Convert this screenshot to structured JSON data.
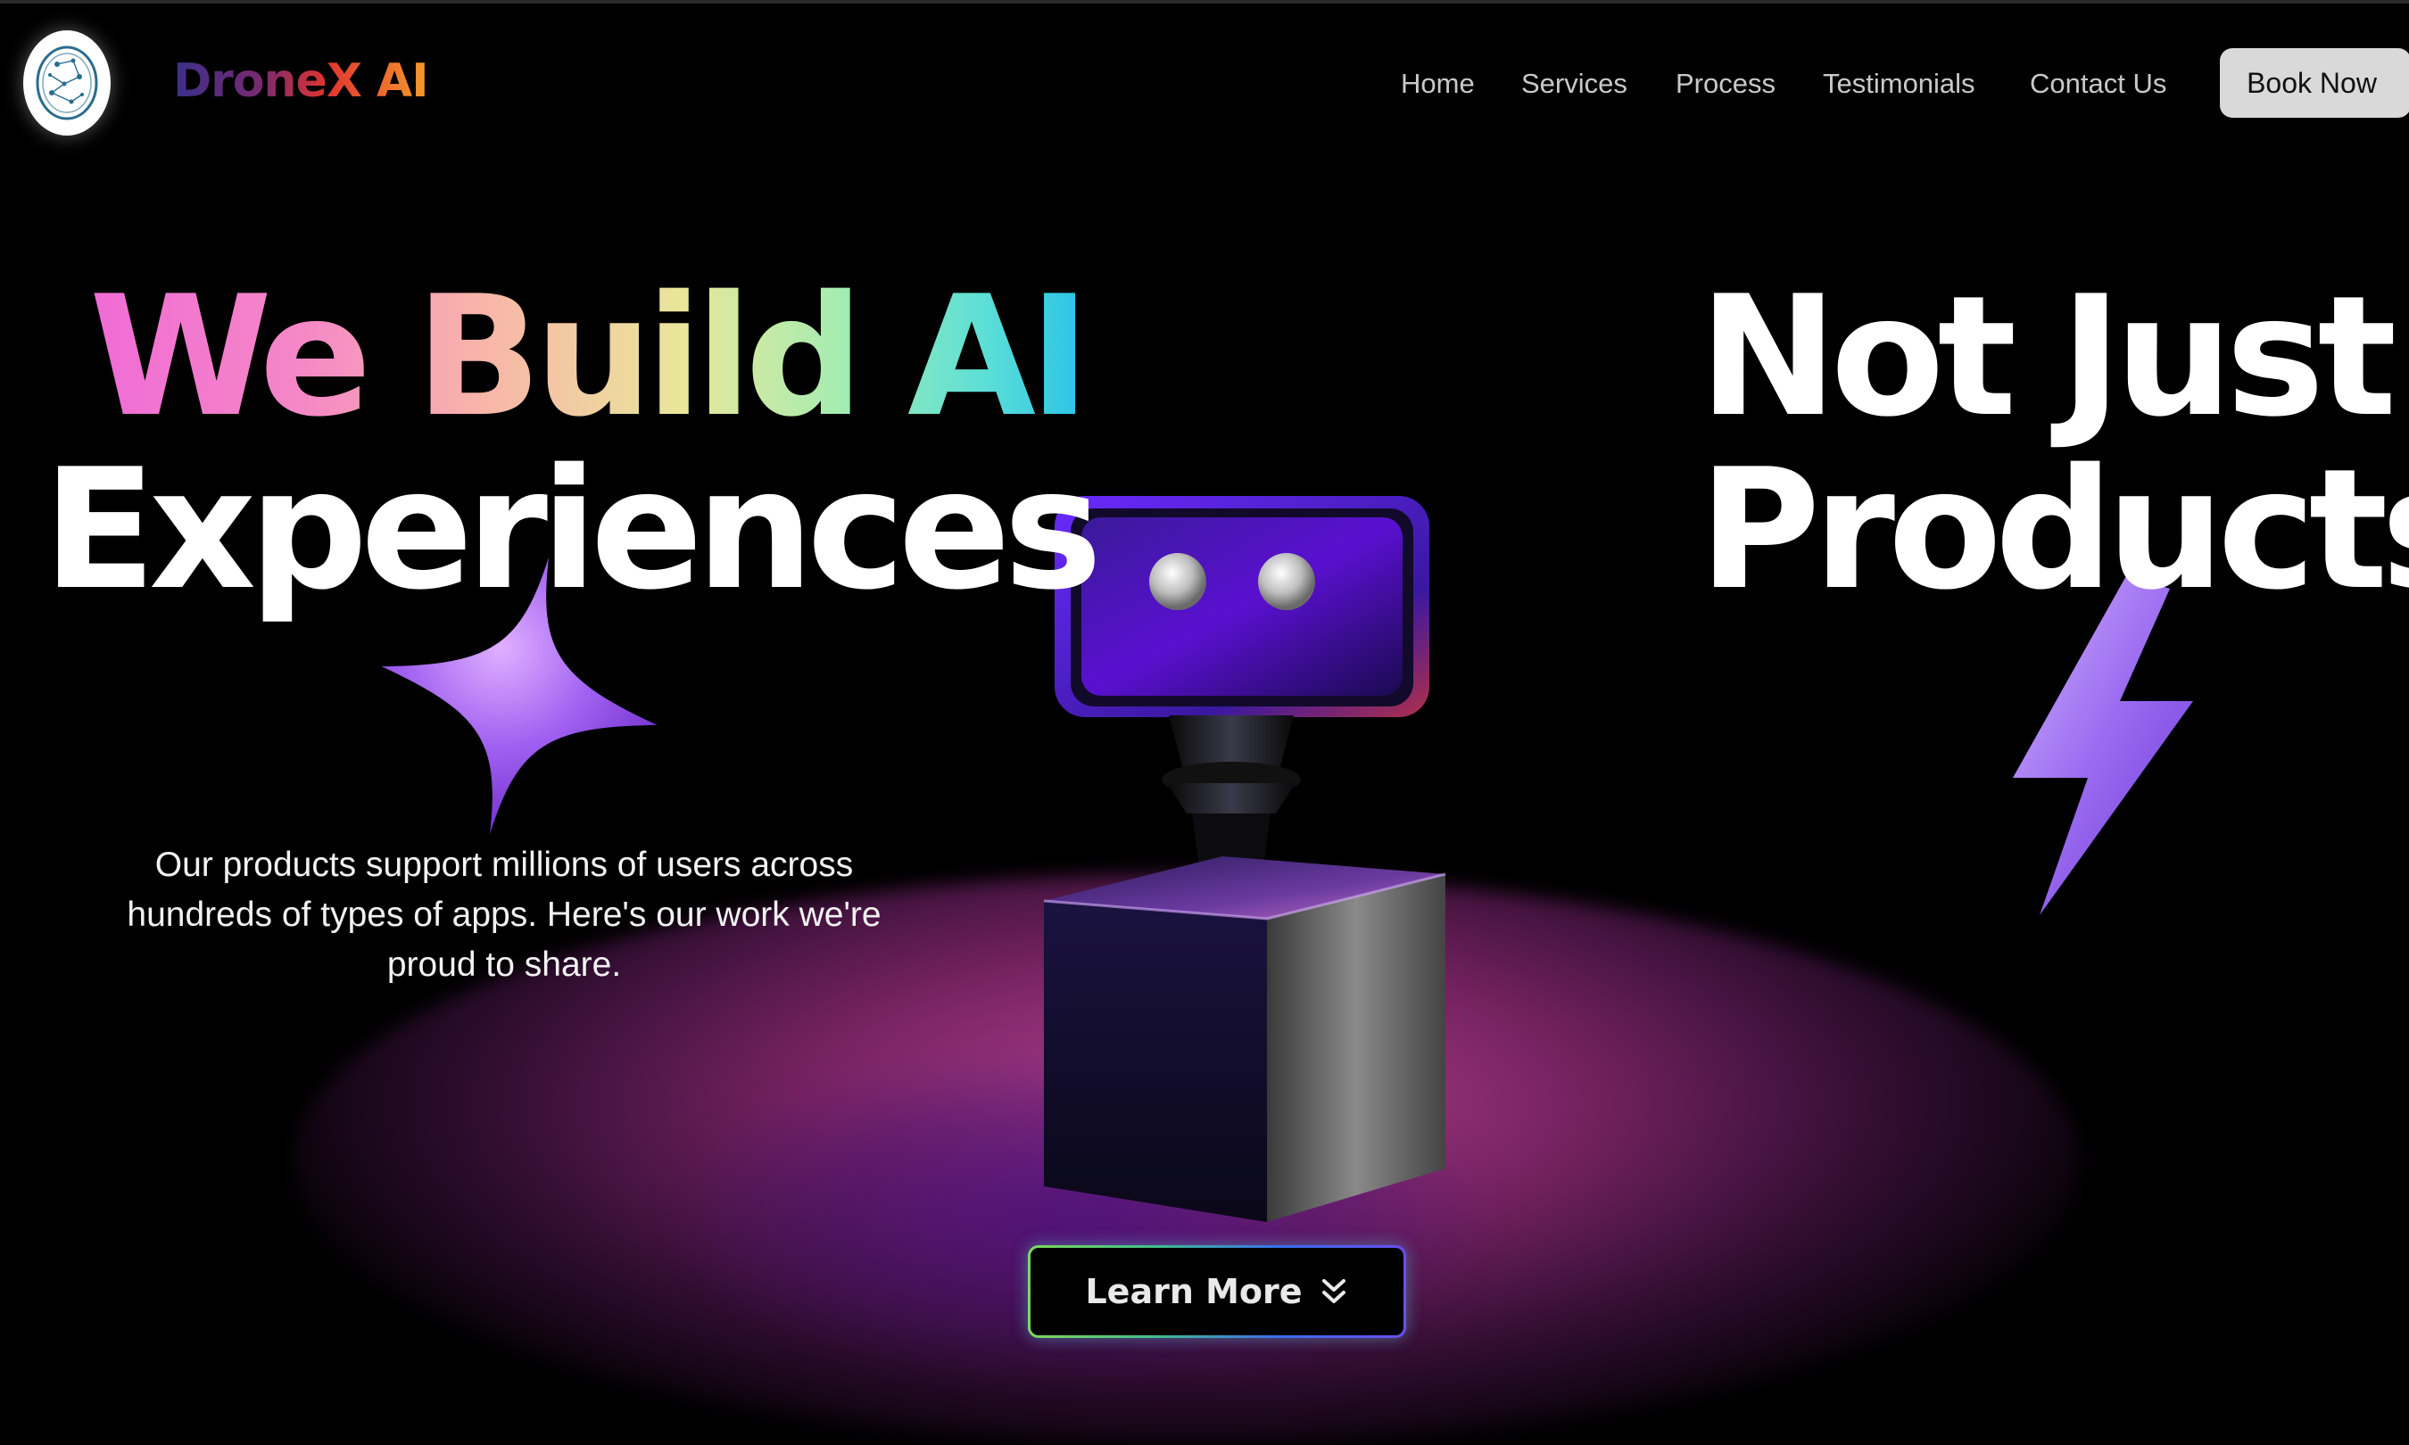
{
  "brand": {
    "name": "DroneX AI",
    "logo_icon": "constellation-logo-icon"
  },
  "nav": {
    "items": [
      "Home",
      "Services",
      "Process",
      "Testimonials",
      "Contact Us"
    ],
    "cta": "Book Now"
  },
  "hero": {
    "line1": "We Build AI",
    "line2": "Experiences",
    "line3": "Not Just",
    "line4": "Products",
    "description": "Our products support millions of users across hundreds of types of apps. Here's our work we're proud to share.",
    "button_label": "Learn More",
    "button_icon": "double-chevron-down-icon"
  },
  "decorations": [
    "sparkle-star-icon",
    "lightning-bolt-icon",
    "robot-illustration"
  ],
  "colors": {
    "background": "#000000",
    "accent_purple": "#8a5cf0",
    "spotlight_pink": "#c8489a",
    "cta_bg": "#d9d9d9"
  }
}
